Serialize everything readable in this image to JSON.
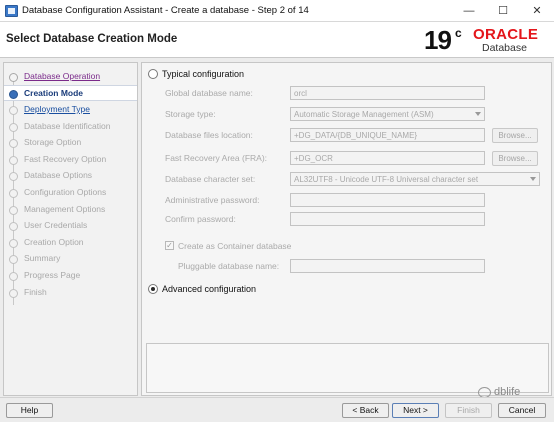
{
  "window": {
    "title": "Database Configuration Assistant - Create a database - Step 2 of 14",
    "minimize": "—",
    "maximize": "☐",
    "close": "✕"
  },
  "header": {
    "page_title": "Select Database Creation Mode",
    "logo_version": "19",
    "logo_version_suffix": "c",
    "logo_brand": "ORACLE",
    "logo_product": "Database"
  },
  "steps": [
    {
      "label": "Database Operation",
      "state": "done"
    },
    {
      "label": "Creation Mode",
      "state": "current"
    },
    {
      "label": "Deployment Type",
      "state": "next"
    },
    {
      "label": "Database Identification",
      "state": "pending"
    },
    {
      "label": "Storage Option",
      "state": "pending"
    },
    {
      "label": "Fast Recovery Option",
      "state": "pending"
    },
    {
      "label": "Database Options",
      "state": "pending"
    },
    {
      "label": "Configuration Options",
      "state": "pending"
    },
    {
      "label": "Management Options",
      "state": "pending"
    },
    {
      "label": "User Credentials",
      "state": "pending"
    },
    {
      "label": "Creation Option",
      "state": "pending"
    },
    {
      "label": "Summary",
      "state": "pending"
    },
    {
      "label": "Progress Page",
      "state": "pending"
    },
    {
      "label": "Finish",
      "state": "pending"
    }
  ],
  "typical": {
    "label": "Typical configuration",
    "selected": false,
    "fields": {
      "global_db_name_label": "Global database name:",
      "global_db_name_value": "orcl",
      "storage_type_label": "Storage type:",
      "storage_type_value": "Automatic Storage Management (ASM)",
      "db_files_location_label": "Database files location:",
      "db_files_location_value": "+DG_DATA/{DB_UNIQUE_NAME}",
      "fra_label": "Fast Recovery Area (FRA):",
      "fra_value": "+DG_OCR",
      "charset_label": "Database character set:",
      "charset_value": "AL32UTF8 - Unicode UTF-8 Universal character set",
      "admin_password_label": "Administrative password:",
      "admin_password_value": "",
      "confirm_password_label": "Confirm password:",
      "confirm_password_value": "",
      "container_db_label": "Create as Container database",
      "container_db_checked": true,
      "pdb_name_label": "Pluggable database name:",
      "pdb_name_value": ""
    },
    "browse_label": "Browse..."
  },
  "advanced": {
    "label": "Advanced configuration",
    "selected": true
  },
  "footer": {
    "help": "Help",
    "back": "< Back",
    "next": "Next >",
    "finish": "Finish",
    "cancel": "Cancel"
  },
  "watermark": "dblife"
}
